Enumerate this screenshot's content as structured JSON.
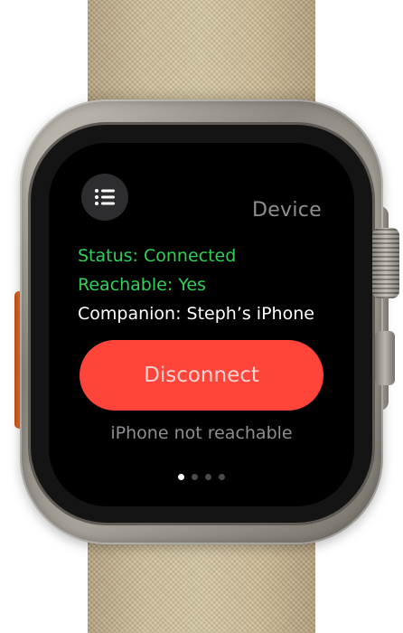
{
  "watch_app": {
    "title": "Device",
    "status_text": "Status: Connected",
    "reachable_text": "Reachable: Yes",
    "companion_text": "Companion: Steph’s iPhone",
    "disconnect_label": "Disconnect",
    "footer_note": "iPhone not reachable",
    "menu_icon": "list-icon",
    "page_indicator": {
      "total": 4,
      "current": 1
    }
  },
  "colors": {
    "accent_green": "#30d158",
    "button_red": "#ff453a",
    "secondary_text": "#8e8e93",
    "band": "#cdbd98",
    "action_button": "#e86e23"
  }
}
